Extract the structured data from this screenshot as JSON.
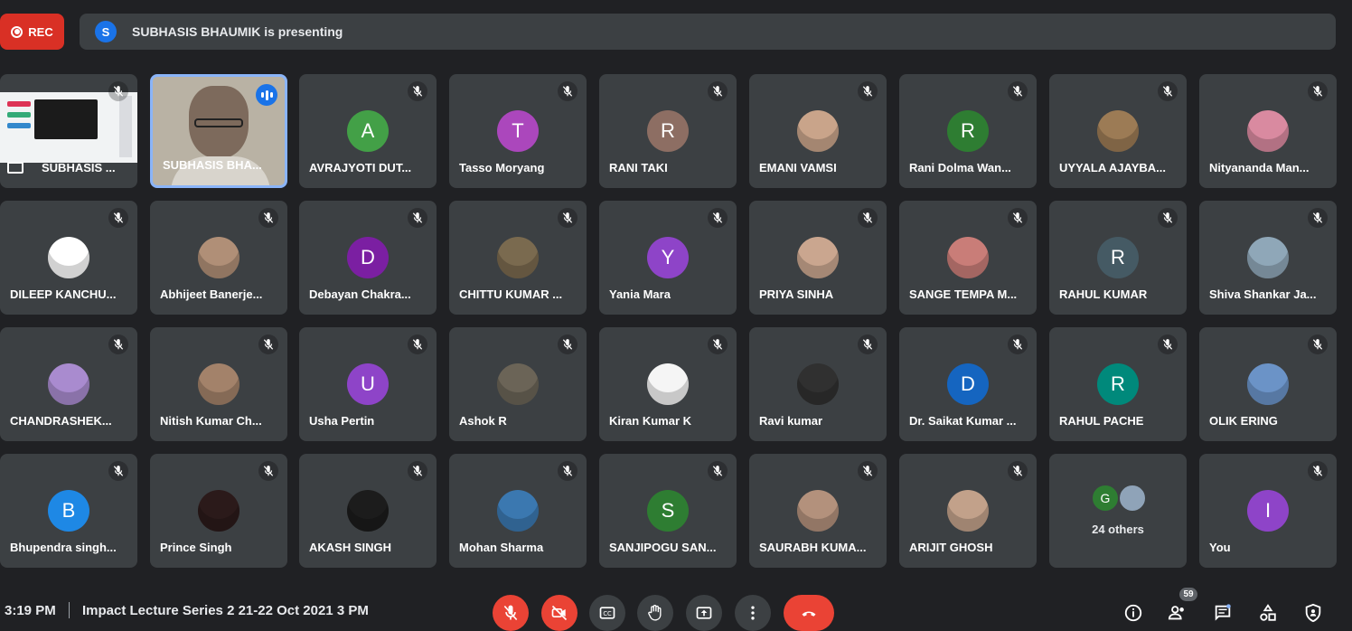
{
  "recording": {
    "label": "REC"
  },
  "presenting_banner": {
    "avatar_letter": "S",
    "text": "SUBHASIS BHAUMIK is presenting"
  },
  "colors": {
    "background": "#202124",
    "tile": "#3c4043",
    "accent": "#8ab4f8",
    "danger": "#ea4335"
  },
  "tiles": [
    {
      "name": "SUBHASIS ...",
      "type": "screen"
    },
    {
      "name": "SUBHASIS BHA...",
      "type": "video",
      "speaking": true
    },
    {
      "name": "AVRAJYOTI DUT...",
      "letter": "A",
      "color": "#43a047"
    },
    {
      "name": "Tasso Moryang",
      "letter": "T",
      "color": "#ab47bc"
    },
    {
      "name": "RANI TAKI",
      "letter": "R",
      "color": "#8d6e63"
    },
    {
      "name": "EMANI VAMSI",
      "photo": "#c9a48a"
    },
    {
      "name": "Rani Dolma Wan...",
      "letter": "R",
      "color": "#2e7d32"
    },
    {
      "name": "UYYALA AJAYBA...",
      "photo": "#9c7b55"
    },
    {
      "name": "Nityananda Man...",
      "photo": "#d98aa0"
    },
    {
      "name": "DILEEP KANCHU...",
      "photo": "#ffffff"
    },
    {
      "name": "Abhijeet Banerje...",
      "photo": "#b08f77"
    },
    {
      "name": "Debayan Chakra...",
      "letter": "D",
      "color": "#7b1fa2"
    },
    {
      "name": "CHITTU KUMAR ...",
      "photo": "#7a6a4f"
    },
    {
      "name": "Yania Mara",
      "letter": "Y",
      "color": "#8e44c8"
    },
    {
      "name": "PRIYA SINHA",
      "photo": "#caa68f"
    },
    {
      "name": "SANGE TEMPA M...",
      "photo": "#c97d78"
    },
    {
      "name": "RAHUL KUMAR",
      "letter": "R",
      "color": "#455a64"
    },
    {
      "name": "Shiva Shankar Ja...",
      "photo": "#8fa7b8"
    },
    {
      "name": "CHANDRASHEK...",
      "photo": "#a98bcf"
    },
    {
      "name": "Nitish Kumar Ch...",
      "photo": "#a3826a"
    },
    {
      "name": "Usha Pertin",
      "letter": "U",
      "color": "#8e44c8"
    },
    {
      "name": "Ashok R",
      "photo": "#6b6457"
    },
    {
      "name": "Kiran Kumar K",
      "photo": "#f5f5f5"
    },
    {
      "name": "Ravi kumar",
      "photo": "#303030"
    },
    {
      "name": "Dr. Saikat Kumar ...",
      "letter": "D",
      "color": "#1565c0"
    },
    {
      "name": "RAHUL PACHE",
      "letter": "R",
      "color": "#00897b"
    },
    {
      "name": "OLIK ERING",
      "photo": "#6b93c7"
    },
    {
      "name": "Bhupendra singh...",
      "letter": "B",
      "color": "#1e88e5"
    },
    {
      "name": "Prince Singh",
      "photo": "#2b1a1a"
    },
    {
      "name": "AKASH SINGH",
      "photo": "#1c1c1c"
    },
    {
      "name": "Mohan Sharma",
      "photo": "#3b78b0"
    },
    {
      "name": "SANJIPOGU SAN...",
      "letter": "S",
      "color": "#2e7d32"
    },
    {
      "name": "SAURABH KUMA...",
      "photo": "#b3917c"
    },
    {
      "name": "ARIJIT GHOSH",
      "photo": "#c2a18a"
    },
    {
      "others": true,
      "letter": "G",
      "label": "24 others"
    },
    {
      "name": "You",
      "letter": "I",
      "color": "#8e44c8"
    }
  ],
  "bottom": {
    "time": "3:19 PM",
    "meeting_title": "Impact Lecture Series 2 21-22 Oct 2021 3 PM",
    "controls": [
      "mic-off-icon",
      "camera-off-icon",
      "captions-icon",
      "raise-hand-icon",
      "present-icon",
      "more-icon",
      "end-call-icon"
    ],
    "right_icons": [
      "info-icon",
      "people-icon",
      "chat-icon",
      "activities-icon",
      "host-controls-icon"
    ],
    "people_count": "59"
  }
}
